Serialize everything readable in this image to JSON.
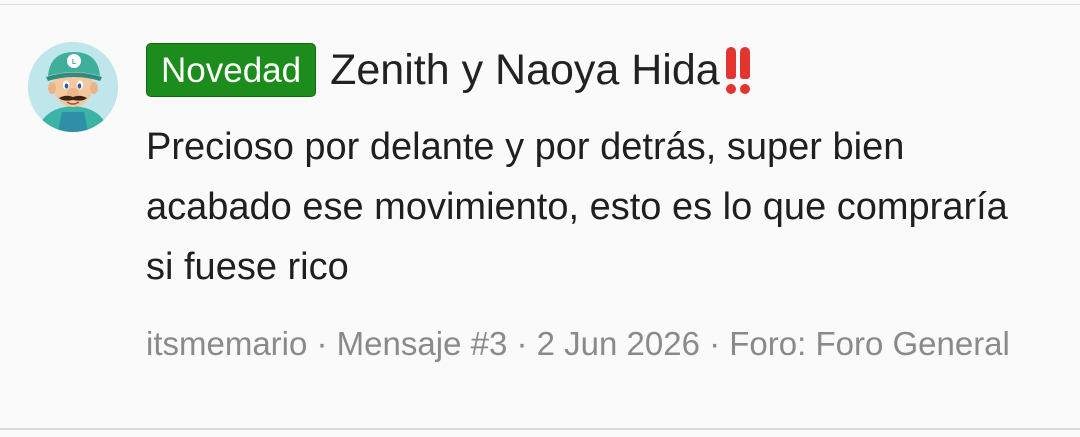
{
  "post": {
    "avatar_icon": "luigi-avatar-icon",
    "badge": "Novedad",
    "badge_color": "#1c8c1c",
    "title": "Zenith y Naoya Hida",
    "title_icon": "double-exclamation-icon",
    "body": "Precioso por delante y por detrás, super bien acabado ese movimiento, esto es lo que compraría si fuese rico",
    "meta": "itsmemario · Mensaje #3 · 2 Jun 2026 · Foro: Foro General"
  }
}
